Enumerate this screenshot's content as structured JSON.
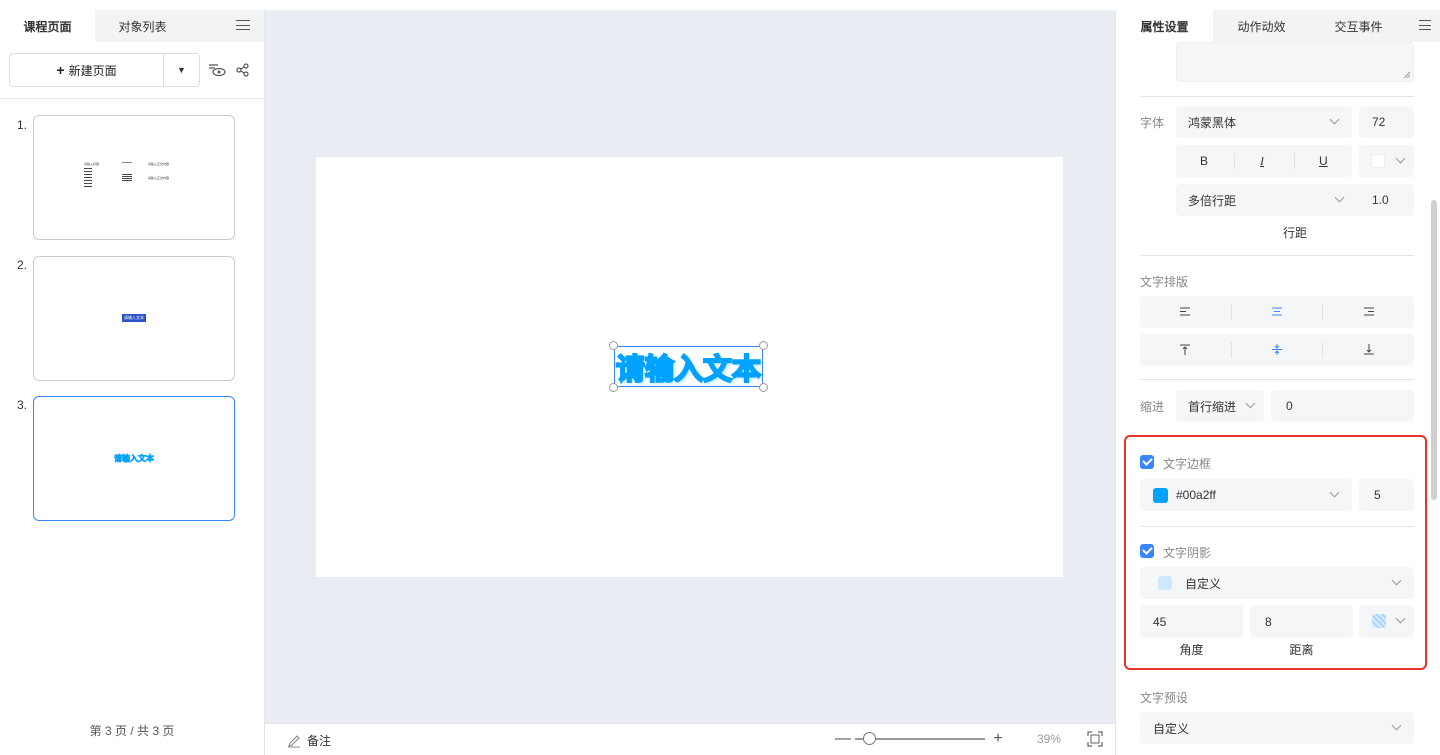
{
  "left_panel": {
    "tabs": [
      "课程页面",
      "对象列表"
    ],
    "new_page_label": "新建页面",
    "new_page_plus": "+",
    "dropdown_arrow": "▼",
    "pages": [
      {
        "num": "1.",
        "preview_text": [
          "请输入标题",
          "请输入正文内容",
          "请输入正文内容"
        ]
      },
      {
        "num": "2.",
        "preview_text": [
          "请输入文本"
        ]
      },
      {
        "num": "3.",
        "preview_text": [
          "请输入文本"
        ]
      }
    ],
    "page_count": "第 3 页 / 共 3 页"
  },
  "canvas": {
    "textbox_text": "请输入文本",
    "text_stroke_color": "#00a2ff"
  },
  "bottom_bar": {
    "note_label": "备注",
    "zoom_percent": "39%",
    "zoom_minus": "—",
    "zoom_plus": "+"
  },
  "right_panel": {
    "tabs": [
      "属性设置",
      "动作动效",
      "交互事件"
    ],
    "font_label": "字体",
    "font_family": "鸿蒙黑体",
    "font_size": "72",
    "bold": "B",
    "italic": "I",
    "underline": "U",
    "line_mode": "多倍行距",
    "line_value": "1.0",
    "line_label": "行距",
    "layout_label": "文字排版",
    "indent_label": "缩进",
    "indent_mode": "首行缩进",
    "indent_value": "0",
    "border": {
      "label": "文字边框",
      "checked": true,
      "color_hex": "#00a2ff",
      "width": "5"
    },
    "shadow": {
      "label": "文字阴影",
      "checked": true,
      "mode": "自定义",
      "swatch_color": "#cfe8ff",
      "angle": "45",
      "distance": "8",
      "angle_label": "角度",
      "distance_label": "距离"
    },
    "preset_label": "文字预设",
    "preset_value": "自定义"
  }
}
